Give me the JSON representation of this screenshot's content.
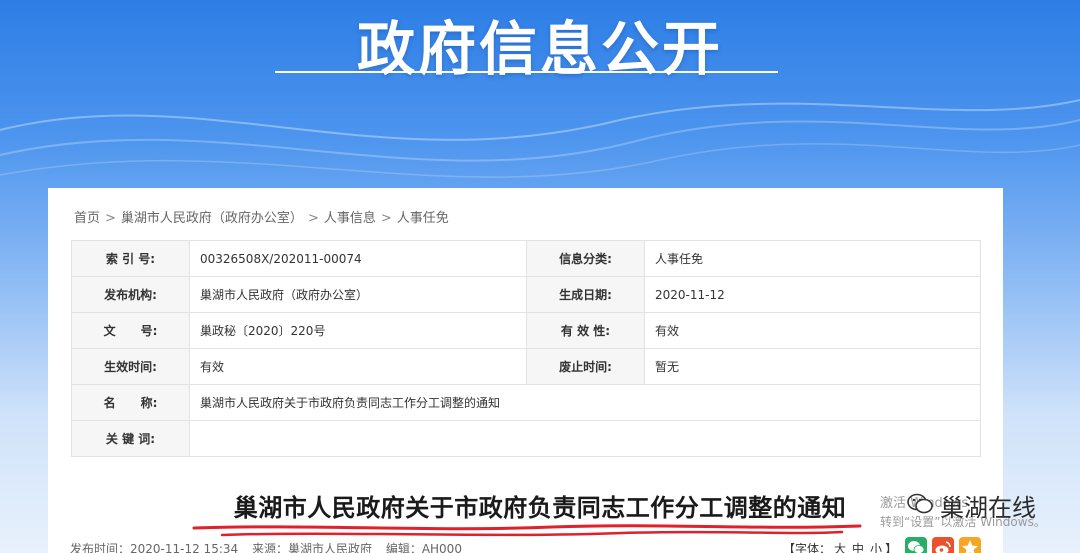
{
  "banner": {
    "title": "政府信息公开"
  },
  "breadcrumb": [
    "首页",
    "巢湖市人民政府（政府办公室）",
    "人事信息",
    "人事任免"
  ],
  "breadcrumb_sep": ">",
  "meta": {
    "index_label": "索 引 号:",
    "index_value": "00326508X/202011-00074",
    "category_label": "信息分类:",
    "category_value": "人事任免",
    "publisher_label": "发布机构:",
    "publisher_value": "巢湖市人民政府（政府办公室）",
    "created_label": "生成日期:",
    "created_value": "2020-11-12",
    "docno_label": "文      号:",
    "docno_value": "巢政秘〔2020〕220号",
    "validity_label": "有 效 性:",
    "validity_value": "有效",
    "effective_label": "生效时间:",
    "effective_value": "有效",
    "abolish_label": "废止时间:",
    "abolish_value": "暂无",
    "name_label": "名      称:",
    "name_value": "巢湖市人民政府关于市政府负责同志工作分工调整的通知",
    "keywords_label": "关 键 词:",
    "keywords_value": ""
  },
  "doc_title": "巢湖市人民政府关于市政府负责同志工作分工调整的通知",
  "pubinfo": {
    "time": "发布时间：2020-11-12 15:34",
    "source": "来源：巢湖市人民政府",
    "editor": "编辑：AH000"
  },
  "fontsize": {
    "prefix": "【字体：",
    "large": "大",
    "medium": "中",
    "small": "小",
    "suffix": "】"
  },
  "overlay": {
    "watermark": "巢湖在线",
    "windows_line1": "激活 Windows",
    "windows_line2": "转到“设置”以激活 Windows。"
  },
  "colors": {
    "banner_top": "#2d7ee6",
    "underline": "#e0202a",
    "wechat": "#2aae67",
    "weibo": "#e8522d",
    "qzone": "#f5a623"
  }
}
